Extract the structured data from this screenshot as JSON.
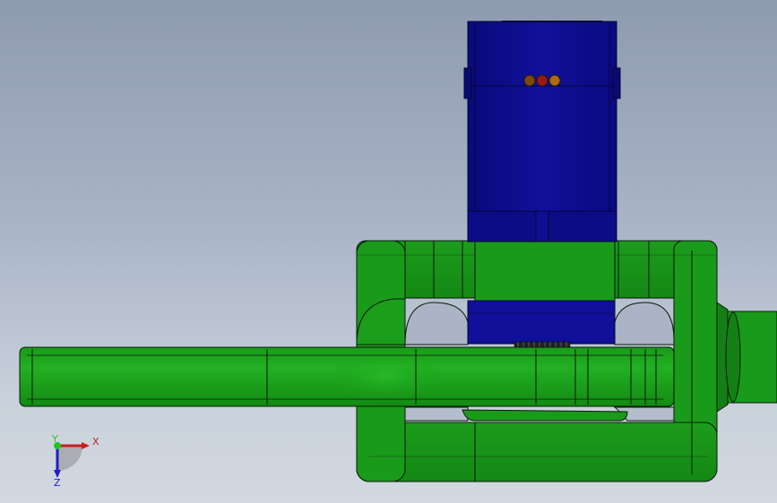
{
  "viewport": {
    "background_top": "#8e9ab0",
    "background_bottom": "#d2d8e0"
  },
  "colors": {
    "green_part": "#1a9e1a",
    "green_dark": "#0f7a0f",
    "green_light": "#2bbd2b",
    "motor_blue": "#0d0d8a",
    "motor_blue_light": "#1414a8",
    "outline": "#0a1a0a",
    "indicator_1": "#7a4a10",
    "indicator_2": "#9a1a10",
    "indicator_3": "#b06a10"
  },
  "triad": {
    "x_label": "X",
    "y_label": "Y",
    "z_label": "Z",
    "x_color": "#c81e1e",
    "y_color": "#1ec81e",
    "z_color": "#1e1ec8"
  }
}
